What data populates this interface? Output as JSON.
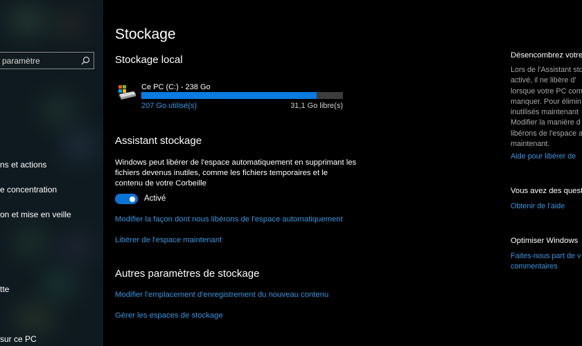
{
  "sidebar": {
    "search_placeholder": "paramètre",
    "items": [
      {
        "label": "ns et actions",
        "icon": "notifications-icon"
      },
      {
        "label": "e concentration",
        "icon": "focus-assist-icon"
      },
      {
        "label": "on et mise en veille",
        "icon": "power-sleep-icon"
      },
      {
        "label": "tte",
        "icon": "battery-icon"
      },
      {
        "label": "sur ce PC",
        "icon": "projecting-icon"
      }
    ]
  },
  "main": {
    "title": "Stockage",
    "local_storage": {
      "heading": "Stockage local",
      "drive": {
        "name": "Ce PC (C:) - 238 Go",
        "used": "207 Go utilisé(s)",
        "free": "31,1 Go libre(s)",
        "used_fraction": 0.87,
        "icon": "hard-drive-icon"
      }
    },
    "storage_sense": {
      "heading": "Assistant stockage",
      "description": "Windows peut libérer de l'espace automatiquement en supprimant les fichiers devenus inutiles, comme les fichiers temporaires et le contenu de votre Corbeille",
      "toggle_on": true,
      "toggle_label": "Activé",
      "link_change": "Modifier la façon dont nous libérons de l'espace automatiquement",
      "link_free_now": "Libérer de l'espace maintenant"
    },
    "other": {
      "heading": "Autres paramètres de stockage",
      "link_save_location": "Modifier l'emplacement d'enregistrement du nouveau contenu",
      "link_spaces": "Gérer les espaces de stockage"
    }
  },
  "right": {
    "declutter_heading": "Désencombrez votre",
    "declutter_lines": [
      "Lors de l'Assistant sto",
      "activé, il ne libère d'",
      "lorsque votre PC com",
      "manquer. Pour élimin",
      "inutilisés maintenant",
      "Modifier la manière d",
      "libérons de l'espace a",
      "maintenant."
    ],
    "help_link": "Aide pour libérer de",
    "questions_heading": "Vous avez des questi",
    "get_help_link": "Obtenir de l'aide",
    "improve_heading": "Optimiser Windows",
    "feedback_lines": [
      "Faites-nous part de v",
      "commentaires"
    ]
  },
  "colors": {
    "accent": "#0a7be0",
    "link": "#3a96dd",
    "background": "#000000"
  }
}
